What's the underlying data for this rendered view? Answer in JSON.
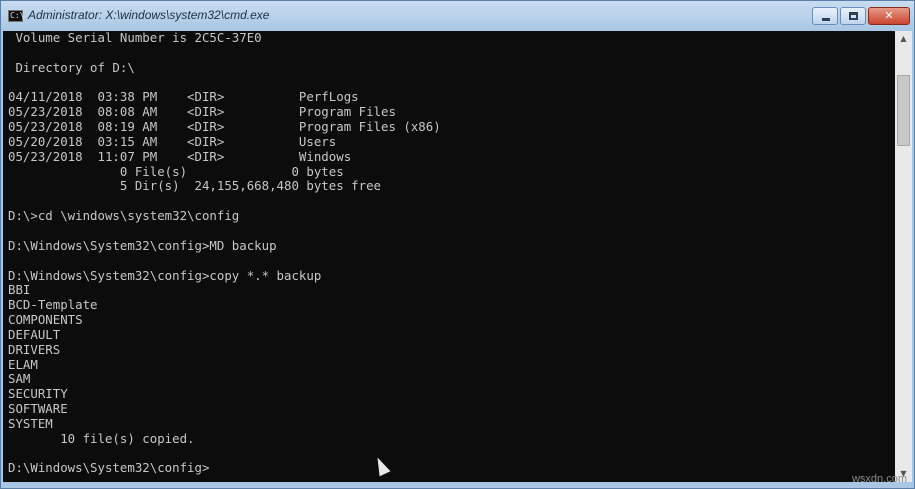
{
  "window": {
    "title": "Administrator: X:\\windows\\system32\\cmd.exe",
    "icon_text": "C:\\"
  },
  "caption_buttons": {
    "minimize": "",
    "maximize": "",
    "close": "✕"
  },
  "console": {
    "lines": [
      " Volume Serial Number is 2C5C-37E0",
      "",
      " Directory of D:\\",
      "",
      "04/11/2018  03:38 PM    <DIR>          PerfLogs",
      "05/23/2018  08:08 AM    <DIR>          Program Files",
      "05/23/2018  08:19 AM    <DIR>          Program Files (x86)",
      "05/20/2018  03:15 AM    <DIR>          Users",
      "05/23/2018  11:07 PM    <DIR>          Windows",
      "               0 File(s)              0 bytes",
      "               5 Dir(s)  24,155,668,480 bytes free",
      "",
      "D:\\>cd \\windows\\system32\\config",
      "",
      "D:\\Windows\\System32\\config>MD backup",
      "",
      "D:\\Windows\\System32\\config>copy *.* backup",
      "BBI",
      "BCD-Template",
      "COMPONENTS",
      "DEFAULT",
      "DRIVERS",
      "ELAM",
      "SAM",
      "SECURITY",
      "SOFTWARE",
      "SYSTEM",
      "       10 file(s) copied.",
      "",
      "D:\\Windows\\System32\\config>"
    ]
  },
  "scrollbar": {
    "up_arrow": "▲",
    "down_arrow": "▼"
  },
  "watermark": "wsxdn.com"
}
